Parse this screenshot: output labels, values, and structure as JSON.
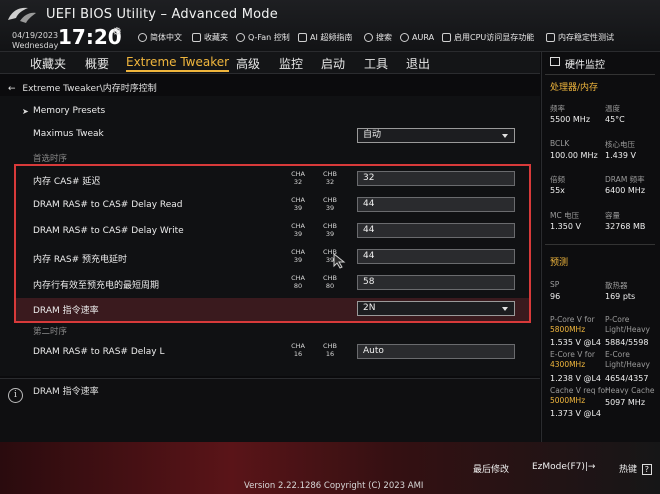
{
  "header": {
    "title": "UEFI BIOS Utility – Advanced Mode",
    "date": "04/19/2023",
    "weekday": "Wednesday",
    "time": "17:20",
    "menu": [
      {
        "icon": "globe-icon",
        "label": "简体中文"
      },
      {
        "icon": "favorites-icon",
        "label": "收藏夹"
      },
      {
        "icon": "fan-icon",
        "label": "Q-Fan 控制"
      },
      {
        "icon": "ai-icon",
        "label": "AI 超频指南"
      },
      {
        "icon": "help-icon",
        "label": "搜索"
      },
      {
        "icon": "aura-icon",
        "label": "AURA"
      },
      {
        "icon": "resize-bar-icon",
        "label": "启用CPU访问显存功能"
      },
      {
        "icon": "memtest-icon",
        "label": "内存稳定性测试"
      }
    ]
  },
  "nav": {
    "tabs": [
      "收藏夹",
      "概要",
      "Extreme Tweaker",
      "高级",
      "监控",
      "启动",
      "工具",
      "退出"
    ],
    "active": "Extreme Tweaker"
  },
  "breadcrumb": "Extreme Tweaker\\内存时序控制",
  "main": {
    "memory_presets": "Memory Presets",
    "maximus_tweak": {
      "label": "Maximus Tweak",
      "value": "自动"
    },
    "primary_header": "首选时序",
    "timings": [
      {
        "label": "内存 CAS# 延迟",
        "cha": "32",
        "chb": "32",
        "value": "32"
      },
      {
        "label": "DRAM RAS# to CAS# Delay Read",
        "cha": "39",
        "chb": "39",
        "value": "44"
      },
      {
        "label": "DRAM RAS# to CAS# Delay Write",
        "cha": "39",
        "chb": "39",
        "value": "44"
      },
      {
        "label": "内存 RAS# 预充电延时",
        "cha": "39",
        "chb": "39",
        "value": "44"
      },
      {
        "label": "内存行有效至预充电的最短周期",
        "cha": "80",
        "chb": "80",
        "value": "58"
      }
    ],
    "ch_a": "CHA",
    "ch_b": "CHB",
    "command_rate": {
      "label": "DRAM 指令速率",
      "value": "2N"
    },
    "secondary_header": "第二时序",
    "rrd_l": {
      "label": "DRAM RAS# to RAS# Delay L",
      "cha": "16",
      "chb": "16",
      "value": "Auto"
    }
  },
  "help": {
    "text": "DRAM 指令速率"
  },
  "monitor": {
    "title": "硬件监控",
    "cpu_section": "处理器/内存",
    "cpu_items": [
      {
        "label": "频率",
        "value": "5500 MHz"
      },
      {
        "label": "温度",
        "value": "45°C"
      },
      {
        "label": "BCLK",
        "value": "100.00 MHz"
      },
      {
        "label": "核心电压",
        "value": "1.439 V"
      },
      {
        "label": "倍频",
        "value": "55x"
      },
      {
        "label": "DRAM 频率",
        "value": "6400 MHz"
      },
      {
        "label": "MC 电压",
        "value": "1.350 V"
      },
      {
        "label": "容量",
        "value": "32768 MB"
      }
    ],
    "predict_section": "预测",
    "sp": {
      "label": "SP",
      "value": "96"
    },
    "cooler": {
      "label": "散热器",
      "value": "169 pts"
    },
    "pcore": {
      "label": "P-Core V for",
      "freq": "5800MHz",
      "value": "1.535 V @L4"
    },
    "pcore_lh": {
      "label": "P-Core Light/Heavy",
      "value": "5884/5598"
    },
    "ecore": {
      "label": "E-Core V for",
      "freq": "4300MHz",
      "value": "1.238 V @L4"
    },
    "ecore_lh": {
      "label": "E-Core Light/Heavy",
      "value": "4654/4357"
    },
    "cache": {
      "label": "Cache V req for",
      "freq": "5000MHz",
      "value": "1.373 V @L4"
    },
    "heavy_cache": {
      "label": "Heavy Cache",
      "value": "5097 MHz"
    }
  },
  "footer": {
    "last_modified": "最后修改",
    "ezmode": "EzMode(F7)|→",
    "hotkeys": "热键",
    "hotkey_mark": "?",
    "version": "Version 2.22.1286 Copyright (C) 2023 AMI"
  }
}
